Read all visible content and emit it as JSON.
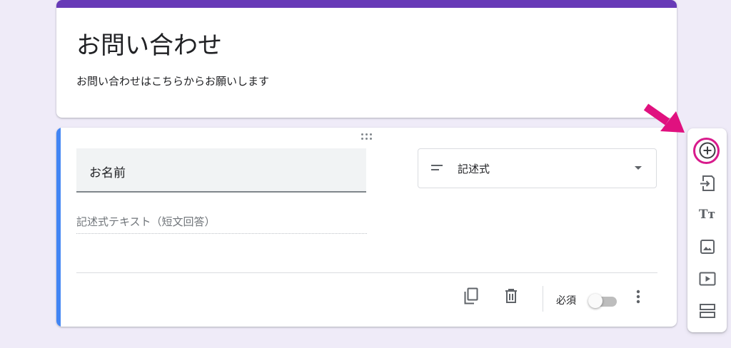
{
  "form": {
    "title": "お問い合わせ",
    "description": "お問い合わせはこちらからお願いします"
  },
  "question": {
    "title": "お名前",
    "type_label": "記述式",
    "answer_placeholder": "記述式テキスト（短文回答）",
    "required_label": "必須",
    "required": false
  },
  "toolbar": {
    "items": [
      {
        "icon": "add-circle-icon"
      },
      {
        "icon": "import-icon"
      },
      {
        "icon": "title-text-icon",
        "glyph": "Tт"
      },
      {
        "icon": "image-icon"
      },
      {
        "icon": "video-icon"
      },
      {
        "icon": "section-icon"
      }
    ]
  },
  "colors": {
    "theme": "#673ab7",
    "active_question": "#4285f4",
    "annotation": "#e0117f",
    "background": "#efebf8"
  }
}
